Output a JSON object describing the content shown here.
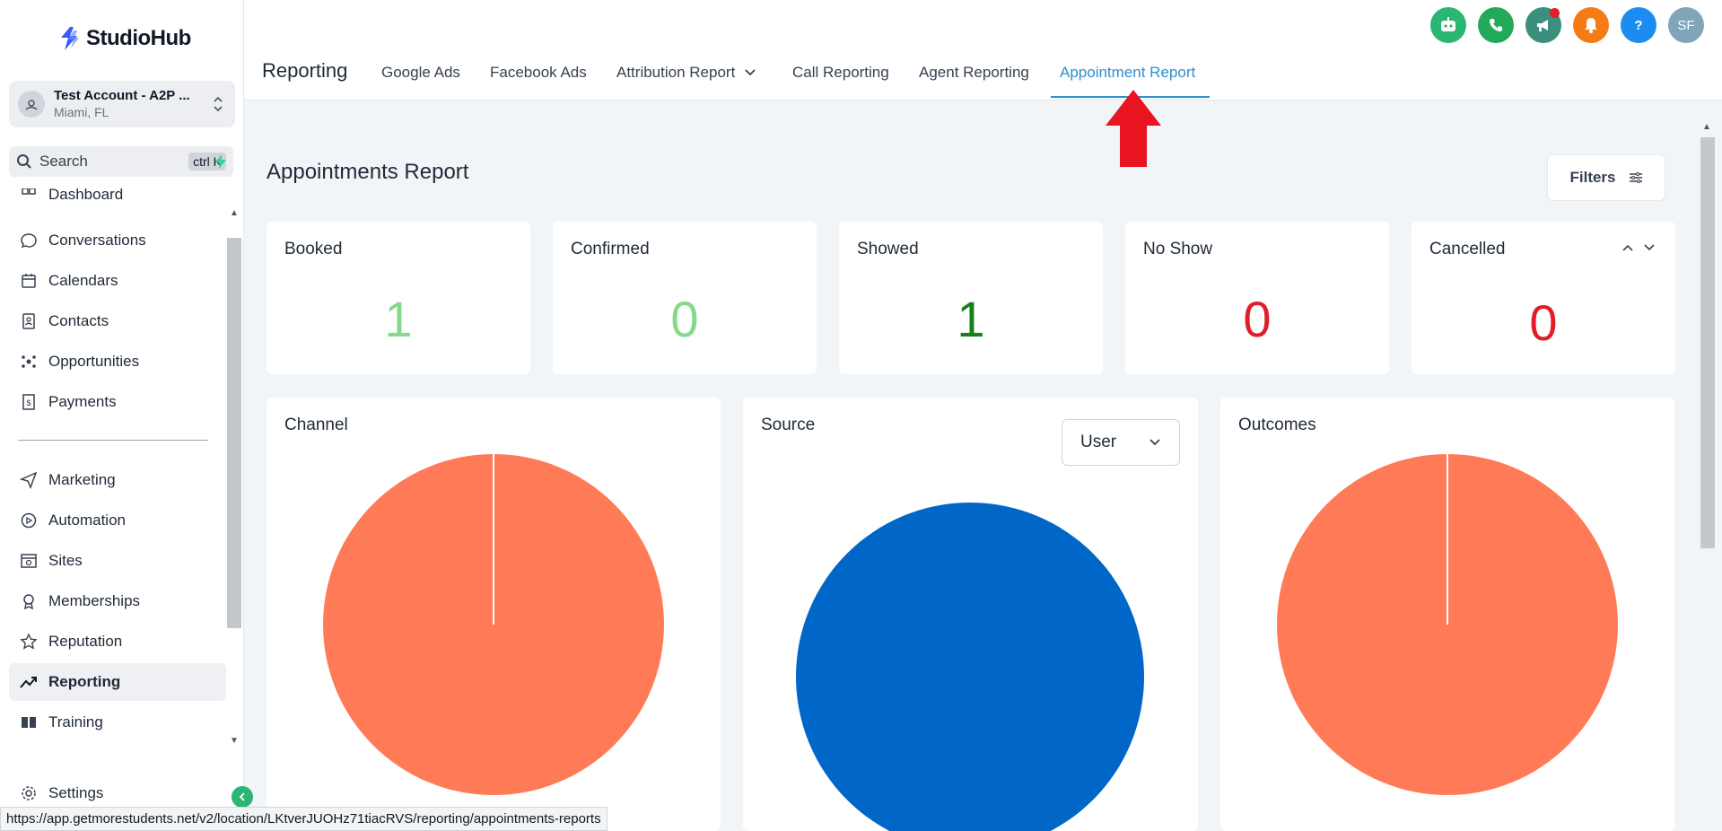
{
  "app": {
    "logo": "StudioHub"
  },
  "account": {
    "name": "Test Account - A2P ...",
    "location": "Miami, FL"
  },
  "search": {
    "label": "Search",
    "shortcut": "ctrl K"
  },
  "sidebar": {
    "items": [
      {
        "label": "Dashboard",
        "icon": "dashboard-icon"
      },
      {
        "label": "Conversations",
        "icon": "chat-icon"
      },
      {
        "label": "Calendars",
        "icon": "calendar-icon"
      },
      {
        "label": "Contacts",
        "icon": "contacts-icon"
      },
      {
        "label": "Opportunities",
        "icon": "opportunities-icon"
      },
      {
        "label": "Payments",
        "icon": "payments-icon"
      },
      {
        "label": "Marketing",
        "icon": "send-icon"
      },
      {
        "label": "Automation",
        "icon": "automation-icon"
      },
      {
        "label": "Sites",
        "icon": "sites-icon"
      },
      {
        "label": "Memberships",
        "icon": "memberships-icon"
      },
      {
        "label": "Reputation",
        "icon": "star-icon"
      },
      {
        "label": "Reporting",
        "icon": "trend-icon"
      },
      {
        "label": "Training",
        "icon": "book-icon"
      }
    ],
    "active": "Reporting",
    "settings_label": "Settings"
  },
  "header": {
    "title": "Reporting",
    "tabs": [
      {
        "label": "Google Ads"
      },
      {
        "label": "Facebook Ads"
      },
      {
        "label": "Attribution Report"
      },
      {
        "label": "Call Reporting"
      },
      {
        "label": "Agent Reporting"
      },
      {
        "label": "Appointment Report"
      }
    ],
    "active_tab": "Appointment Report",
    "avatar_initials": "SF",
    "help_label": "?"
  },
  "colors": {
    "accent": "#2e8fd1",
    "green_light": "#86d98a",
    "green_dark": "#1a7f1a",
    "red": "#e11d2a",
    "pie_orange": "#ff7b57",
    "pie_blue": "#0066c8"
  },
  "main": {
    "title": "Appointments Report",
    "filters_label": "Filters",
    "stats": [
      {
        "label": "Booked",
        "value": "1"
      },
      {
        "label": "Confirmed",
        "value": "0"
      },
      {
        "label": "Showed",
        "value": "1"
      },
      {
        "label": "No Show",
        "value": "0"
      },
      {
        "label": "Cancelled",
        "value": "0"
      }
    ],
    "panels": [
      {
        "title": "Channel"
      },
      {
        "title": "Source",
        "select_value": "User"
      },
      {
        "title": "Outcomes"
      }
    ]
  },
  "status_url": "https://app.getmorestudents.net/v2/location/LKtverJUOHz71tiacRVS/reporting/appointments-reports"
}
